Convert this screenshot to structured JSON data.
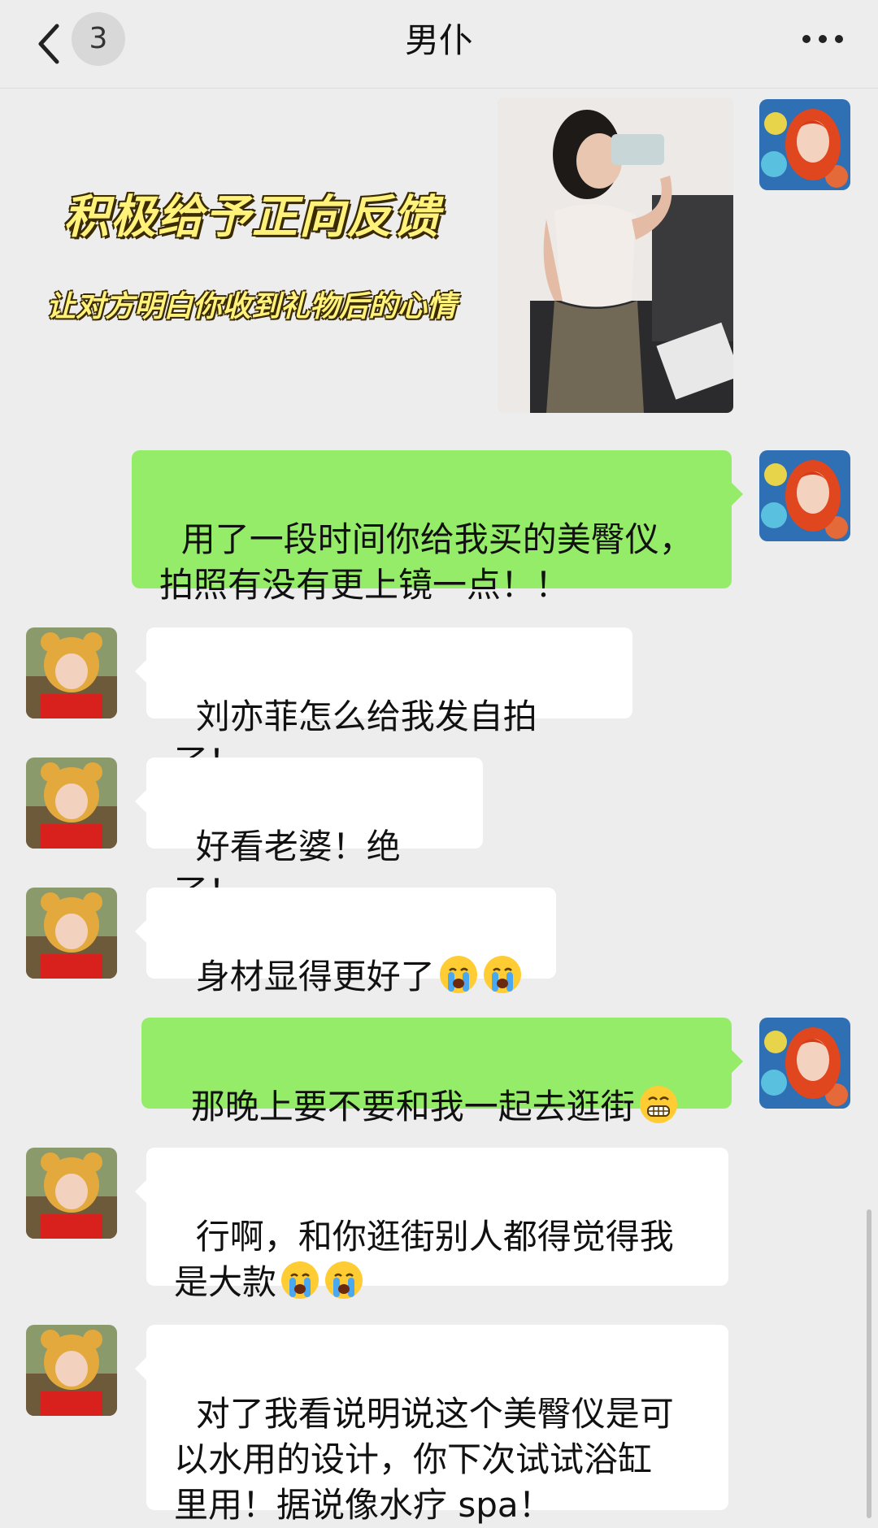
{
  "header": {
    "title": "男仆",
    "unread_count": "3",
    "back_icon": "chevron-left-icon",
    "more_icon": "ellipsis-icon"
  },
  "overlay": {
    "title": "积极给予正向反馈",
    "subtitle": "让对方明白你收到礼物后的心情"
  },
  "messages": [
    {
      "side": "sent",
      "type": "image",
      "desc_icon": "photo-thumbnail"
    },
    {
      "side": "sent",
      "text": "用了一段时间你给我买的美臀仪，\n拍照有没有更上镜一点！！"
    },
    {
      "side": "recv",
      "text": "刘亦菲怎么给我发自拍了！"
    },
    {
      "side": "recv",
      "text": "好看老婆！绝了！"
    },
    {
      "side": "recv",
      "text": "身材显得更好了",
      "emoji": "crying-face-icon ×2"
    },
    {
      "side": "sent",
      "text": "那晚上要不要和我一起去逛街",
      "emoji": "grimacing-face-icon"
    },
    {
      "side": "recv",
      "text": "行啊，和你逛街别人都得觉得我\n是大款",
      "emoji": "crying-face-icon ×2"
    },
    {
      "side": "recv",
      "text": "对了我看说明说这个美臀仪是可\n以水用的设计，你下次试试浴缸\n里用！据说像水疗 spa！"
    }
  ],
  "colors": {
    "background": "#ededed",
    "sent_bubble": "#95ec69",
    "recv_bubble": "#ffffff",
    "overlay_text": "#fff27a"
  }
}
